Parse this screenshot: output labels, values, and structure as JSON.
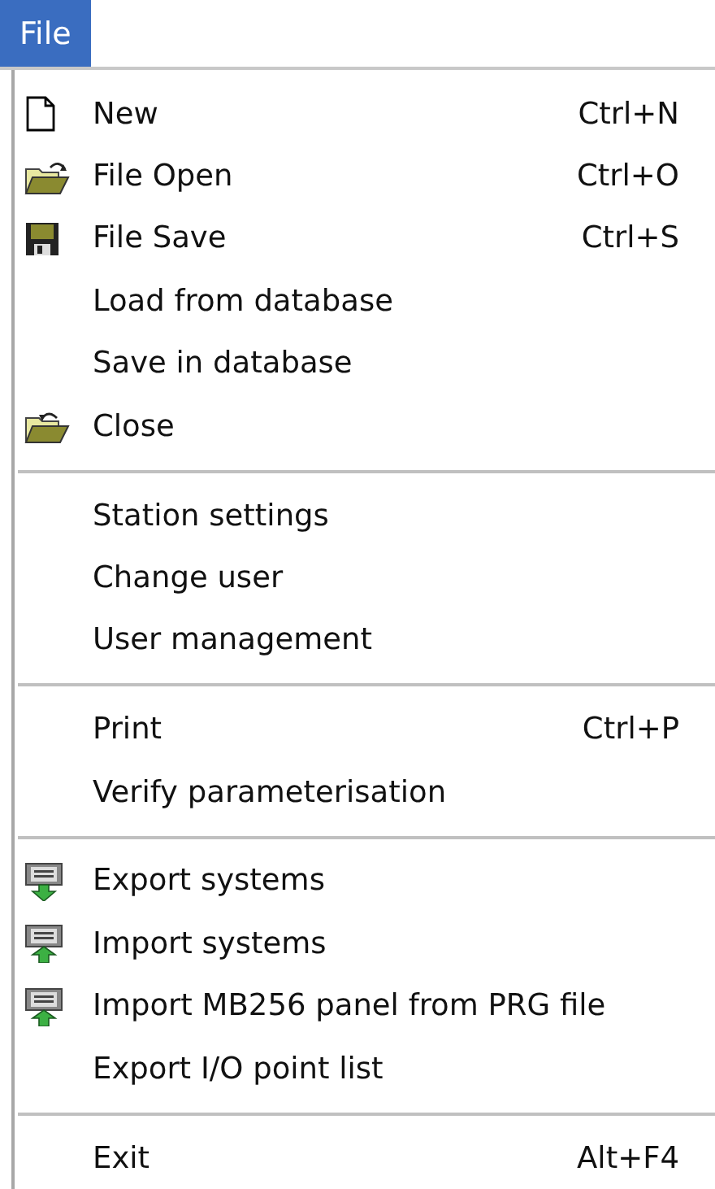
{
  "menu_bar": {
    "title": "File",
    "selected": true
  },
  "menu": {
    "groups": [
      [
        {
          "label": "New",
          "shortcut": "Ctrl+N"
        },
        {
          "label": "File Open",
          "shortcut": "Ctrl+O"
        },
        {
          "label": "File Save",
          "shortcut": "Ctrl+S"
        },
        {
          "label": "Load from database"
        },
        {
          "label": "Save in database"
        },
        {
          "label": "Close"
        }
      ],
      [
        {
          "label": "Station settings"
        },
        {
          "label": "Change user"
        },
        {
          "label": "User management"
        }
      ],
      [
        {
          "label": "Print",
          "shortcut": "Ctrl+P"
        },
        {
          "label": "Verify parameterisation"
        }
      ],
      [
        {
          "label": "Export systems"
        },
        {
          "label": "Import systems"
        },
        {
          "label": "Import MB256 panel from PRG file"
        },
        {
          "label": "Export I/O point list"
        }
      ],
      [
        {
          "label": "Exit",
          "shortcut": "Alt+F4"
        }
      ]
    ]
  }
}
